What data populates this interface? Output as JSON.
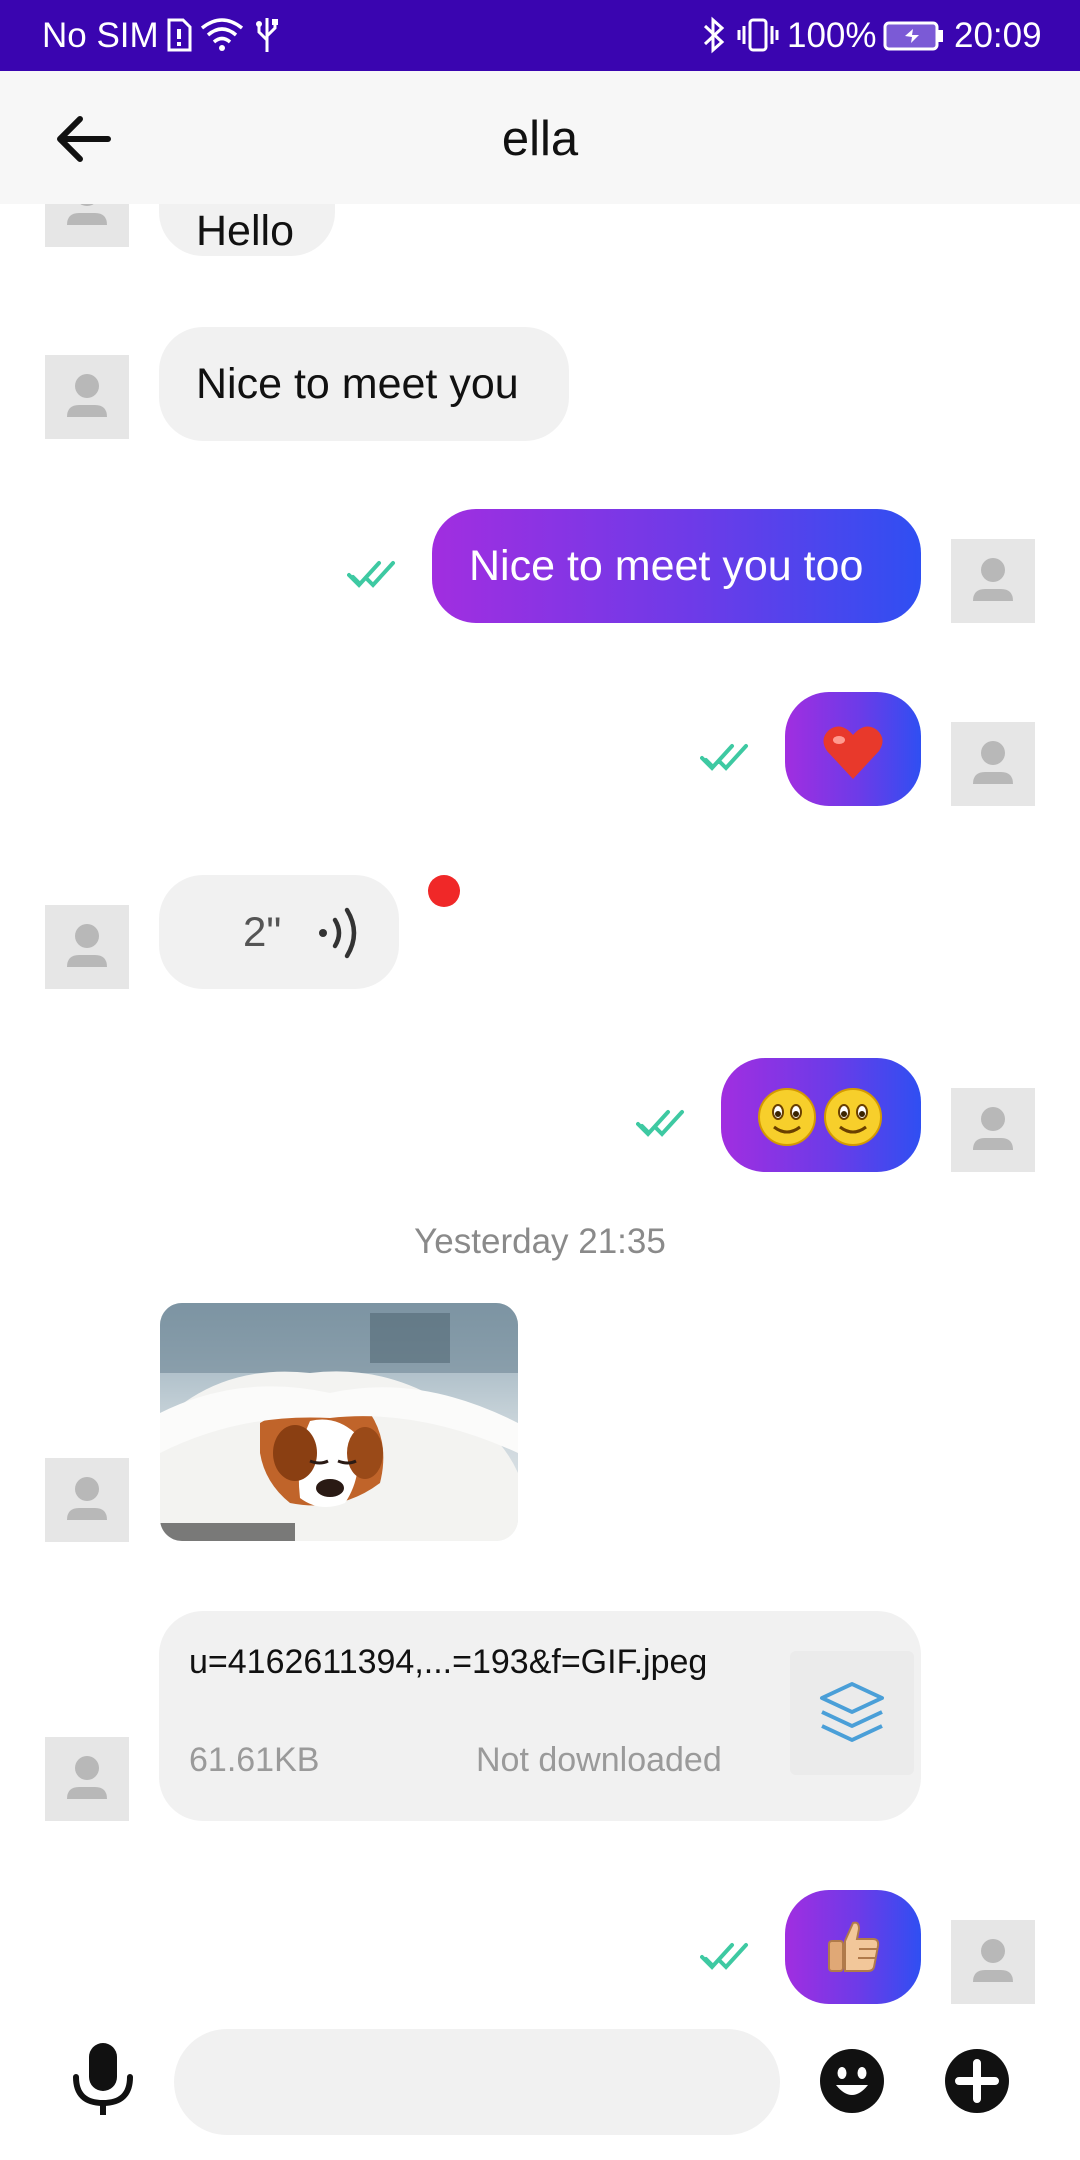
{
  "status_bar": {
    "carrier": "No SIM",
    "battery": "100%",
    "time": "20:09",
    "background": "#3a05b0"
  },
  "header": {
    "title": "ella"
  },
  "messages": [
    {
      "direction": "incoming",
      "type": "text",
      "text": "Hello"
    },
    {
      "direction": "incoming",
      "type": "text",
      "text": "Nice to meet you"
    },
    {
      "direction": "outgoing",
      "type": "text",
      "text": "Nice to meet you too",
      "read": true
    },
    {
      "direction": "outgoing",
      "type": "emoji",
      "text": "❤️",
      "read": true
    },
    {
      "direction": "incoming",
      "type": "voice",
      "duration": "2\"",
      "unread": true
    },
    {
      "direction": "outgoing",
      "type": "emoji",
      "text": "🙂🙂",
      "read": true
    },
    {
      "type": "timestamp",
      "text": "Yesterday 21:35"
    },
    {
      "direction": "incoming",
      "type": "image"
    },
    {
      "direction": "incoming",
      "type": "file",
      "filename": "u=4162611394,...=193&f=GIF.jpeg",
      "size": "61.61KB",
      "status": "Not downloaded"
    },
    {
      "direction": "outgoing",
      "type": "emoji",
      "text": "👍",
      "read": true
    }
  ],
  "input": {
    "value": "",
    "placeholder": ""
  },
  "colors": {
    "accent_gradient_start": "#a12ee0",
    "accent_gradient_end": "#2f4ff2",
    "read_ticks": "#3ec9a2",
    "unread_dot": "#f02828"
  },
  "icons": [
    "back-arrow-icon",
    "microphone-icon",
    "emoji-icon",
    "add-icon",
    "voice-wave-icon",
    "file-layers-icon",
    "read-ticks-icon"
  ]
}
